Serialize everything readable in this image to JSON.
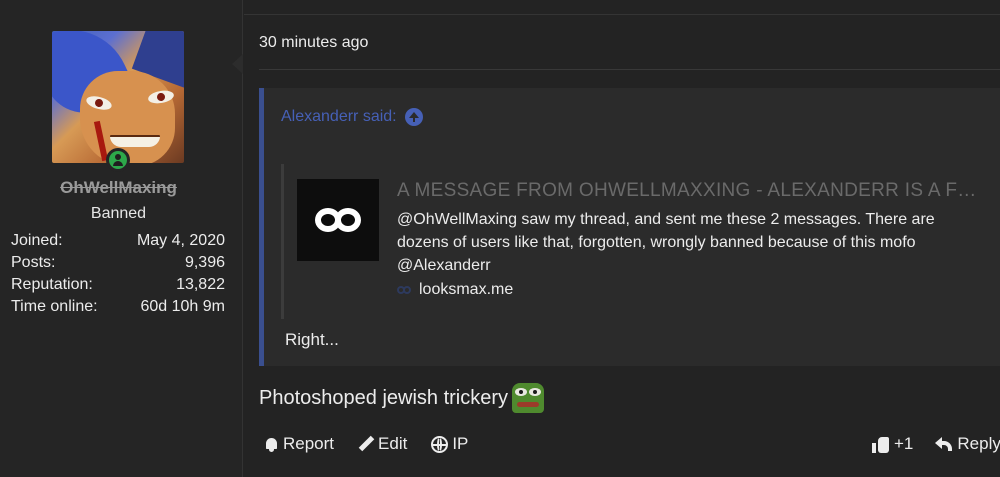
{
  "author": {
    "username": "OhWellMaxing",
    "title": "Banned",
    "stats": [
      {
        "label": "Joined:",
        "value": "May 4, 2020"
      },
      {
        "label": "Posts:",
        "value": "9,396"
      },
      {
        "label": "Reputation:",
        "value": "13,822"
      },
      {
        "label": "Time online:",
        "value": "60d 10h 9m"
      }
    ],
    "online_color": "#2da84a"
  },
  "post": {
    "time": "30 minutes ago",
    "quote": {
      "author_text": "Alexanderr said:",
      "unfurl": {
        "title": "A MESSAGE FROM OHWELLMAXXING - ALEXANDERR IS A FRAUD",
        "description": "@OhWellMaxing saw my thread, and sent me these 2 messages. There are dozens of users like that, forgotten, wrongly banned because of this mofo @Alexanderr",
        "domain": "looksmax.me"
      },
      "body": "Right..."
    },
    "body": "Photoshoped jewish trickery",
    "actions": {
      "report": "Report",
      "edit": "Edit",
      "ip": "IP",
      "like_count": "+1",
      "reply": "Reply"
    }
  },
  "colors": {
    "quote_accent": "#3a4f8f",
    "link": "#4660b6"
  }
}
